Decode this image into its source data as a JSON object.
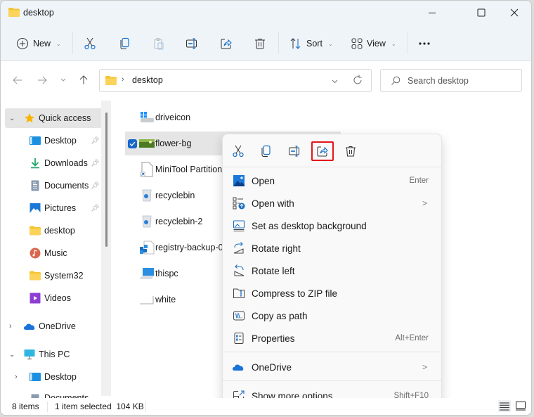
{
  "window": {
    "title": "desktop",
    "controls": {
      "minimize": "minimize",
      "maximize": "maximize",
      "close": "close"
    }
  },
  "commandbar": {
    "new_label": "New",
    "sort_label": "Sort",
    "view_label": "View",
    "tools": [
      "cut",
      "copy",
      "paste",
      "rename",
      "share",
      "delete"
    ],
    "more_label": "..."
  },
  "address": {
    "path": "desktop",
    "search_placeholder": "Search desktop"
  },
  "sidebar": {
    "items": [
      {
        "label": "Quick access",
        "icon": "star-icon",
        "expanded": true,
        "active": true
      },
      {
        "label": "Desktop",
        "icon": "desktop-icon",
        "pinned": true
      },
      {
        "label": "Downloads",
        "icon": "download-icon",
        "pinned": true
      },
      {
        "label": "Documents",
        "icon": "documents-icon",
        "pinned": true
      },
      {
        "label": "Pictures",
        "icon": "pictures-icon",
        "pinned": true
      },
      {
        "label": "desktop",
        "icon": "folder-icon"
      },
      {
        "label": "Music",
        "icon": "music-icon"
      },
      {
        "label": "System32",
        "icon": "folder-icon"
      },
      {
        "label": "Videos",
        "icon": "videos-icon"
      },
      {
        "label": "OneDrive",
        "icon": "onedrive-icon",
        "expanded": false
      },
      {
        "label": "This PC",
        "icon": "this-pc-icon",
        "expanded": true
      },
      {
        "label": "Desktop",
        "icon": "desktop-icon",
        "expanded": false
      },
      {
        "label": "Documents",
        "icon": "documents-icon"
      }
    ]
  },
  "files": [
    {
      "name": "driveicon",
      "icon": "drive-icon"
    },
    {
      "name": "flower-bg",
      "icon": "image-icon",
      "selected": true
    },
    {
      "name": "MiniTool Partition",
      "icon": "shortcut-icon"
    },
    {
      "name": "recyclebin",
      "icon": "recycle-bin-icon"
    },
    {
      "name": "recyclebin-2",
      "icon": "recycle-bin-icon"
    },
    {
      "name": "registry-backup-0",
      "icon": "registry-icon"
    },
    {
      "name": "thispc",
      "icon": "this-pc-icon"
    },
    {
      "name": "white",
      "icon": "blank-image-icon"
    }
  ],
  "context_menu": {
    "toolbar": [
      "Cut",
      "Copy",
      "Rename",
      "Share",
      "Delete"
    ],
    "highlighted_tool": "Share",
    "items": [
      {
        "label": "Open",
        "shortcut": "Enter",
        "icon": "photos-icon"
      },
      {
        "label": "Open with",
        "submenu": true,
        "icon": "open-with-icon"
      },
      {
        "label": "Set as desktop background",
        "icon": "wallpaper-icon"
      },
      {
        "label": "Rotate right",
        "icon": "rotate-right-icon"
      },
      {
        "label": "Rotate left",
        "icon": "rotate-left-icon"
      },
      {
        "label": "Compress to ZIP file",
        "icon": "zip-icon"
      },
      {
        "label": "Copy as path",
        "icon": "copy-path-icon"
      },
      {
        "label": "Properties",
        "shortcut": "Alt+Enter",
        "icon": "properties-icon"
      },
      {
        "label": "OneDrive",
        "submenu": true,
        "icon": "onedrive-icon"
      },
      {
        "label": "Show more options",
        "shortcut": "Shift+F10",
        "icon": "more-options-icon"
      }
    ],
    "submenu_arrow": ">"
  },
  "statusbar": {
    "item_count": "8 items",
    "selection": "1 item selected  104 KB"
  },
  "colors": {
    "accent": "#1866c9",
    "highlight_box": "#e5161a",
    "folder": "#f4c430",
    "chrome_bg": "#eff4f9"
  }
}
